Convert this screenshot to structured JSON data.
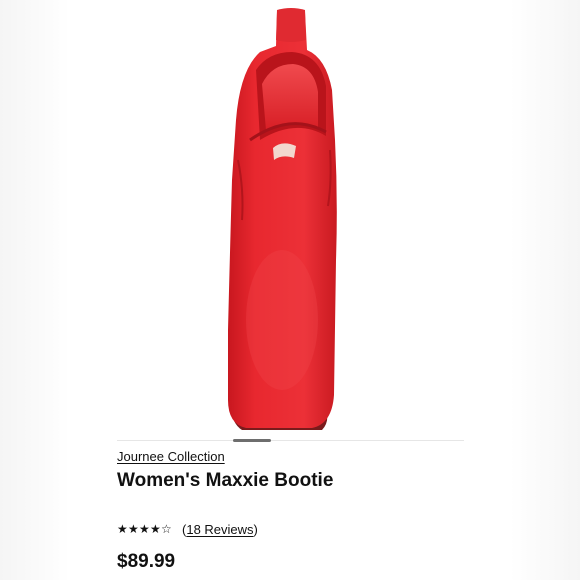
{
  "product": {
    "brand": "Journee Collection",
    "title": "Women's Maxxie Bootie",
    "rating": 4.5,
    "rating_max": 5,
    "stars": [
      "★",
      "★",
      "★",
      "★",
      "☆"
    ],
    "reviews_open": "(",
    "reviews_text": "18 Reviews",
    "reviews_close": ")",
    "price": "$89.99",
    "image_color": "#e8282f"
  },
  "carousel": {
    "active_index": 1
  }
}
